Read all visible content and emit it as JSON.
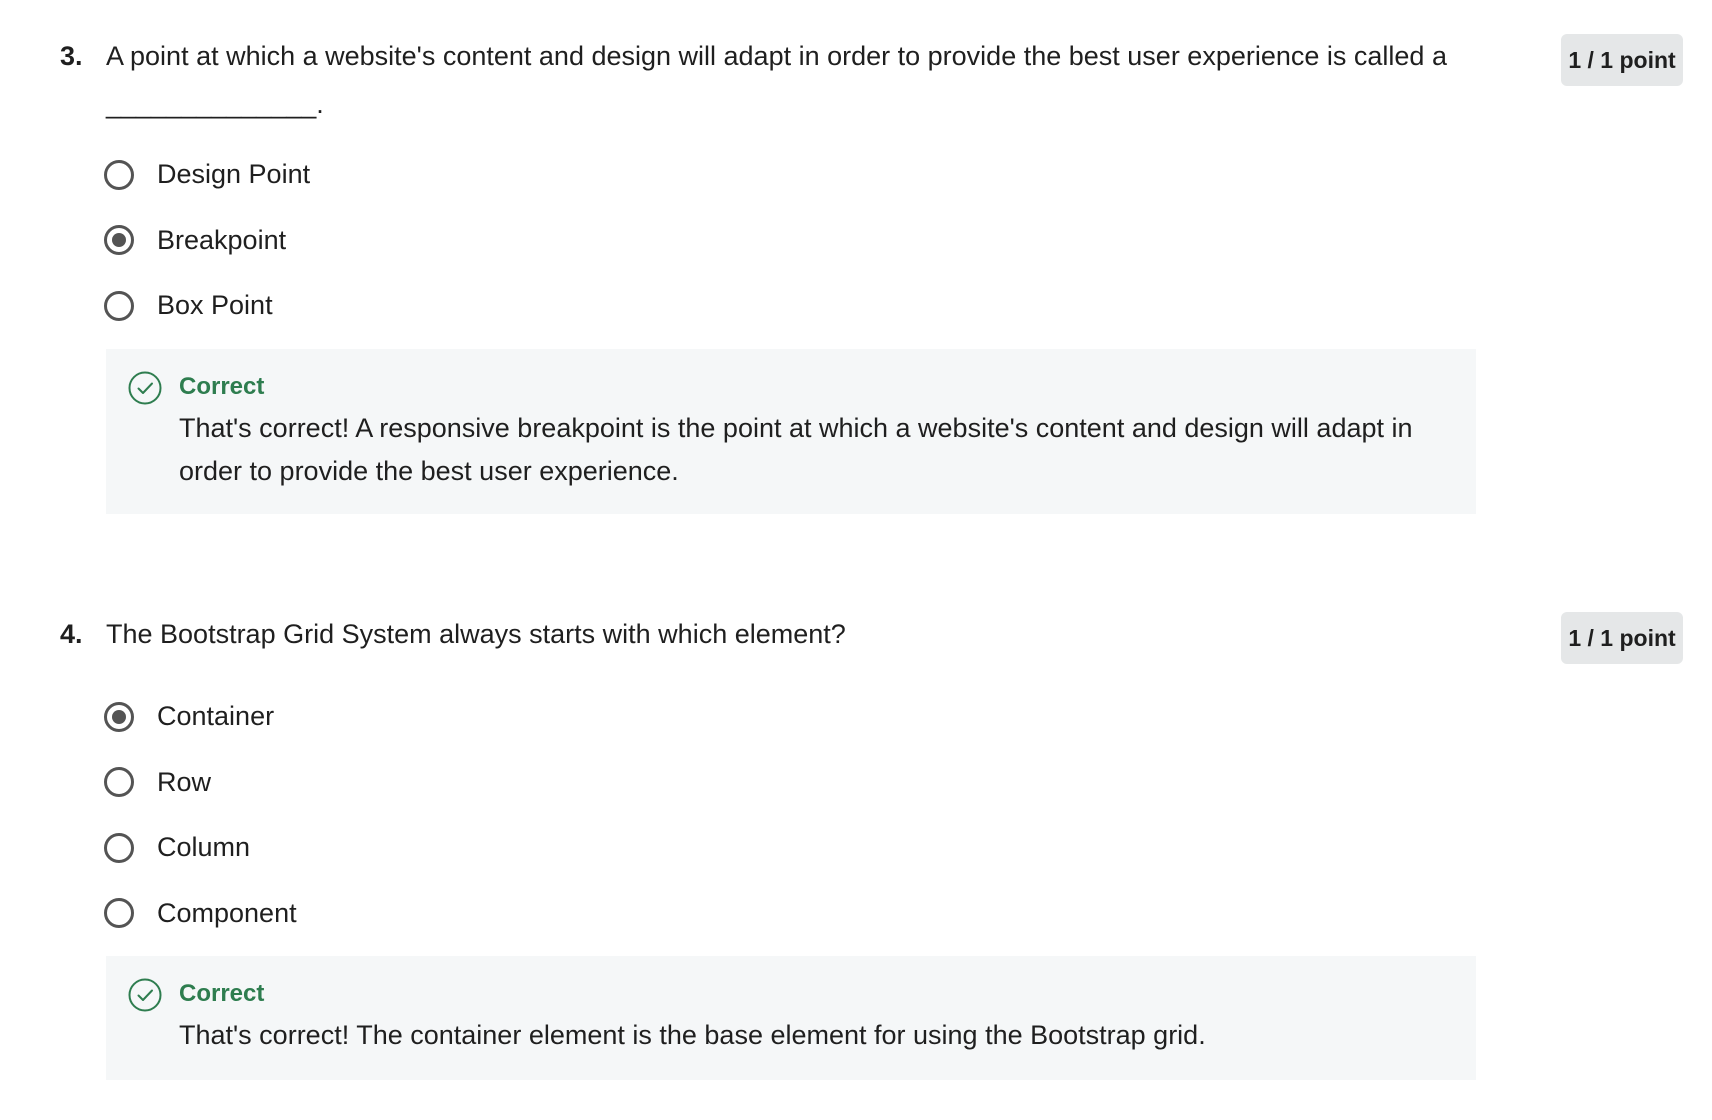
{
  "questions": [
    {
      "number": "3.",
      "text": "A point at which a website's content and design will adapt in order to provide the best user experience is called a",
      "blank": "______________.",
      "points": "1 / 1 point",
      "options": [
        {
          "label": "Design Point",
          "selected": false
        },
        {
          "label": "Breakpoint",
          "selected": true
        },
        {
          "label": "Box Point",
          "selected": false
        }
      ],
      "feedback": {
        "status": "Correct",
        "icon": "check-circle-icon",
        "text": "That's correct! A responsive breakpoint is the point at which a website's content and design will adapt in order to provide the best user experience."
      }
    },
    {
      "number": "4.",
      "text": "The Bootstrap Grid System always starts with which element?",
      "points": "1 / 1 point",
      "options": [
        {
          "label": "Container",
          "selected": true
        },
        {
          "label": "Row",
          "selected": false
        },
        {
          "label": "Column",
          "selected": false
        },
        {
          "label": "Component",
          "selected": false
        }
      ],
      "feedback": {
        "status": "Correct",
        "icon": "check-circle-icon",
        "text": "That's correct! The container element is the base element for using the Bootstrap grid."
      }
    }
  ],
  "colors": {
    "correct_green": "#2e7d4f",
    "feedback_bg": "#f5f7f8",
    "badge_bg": "#e5e7e8",
    "radio_border": "#545454"
  }
}
